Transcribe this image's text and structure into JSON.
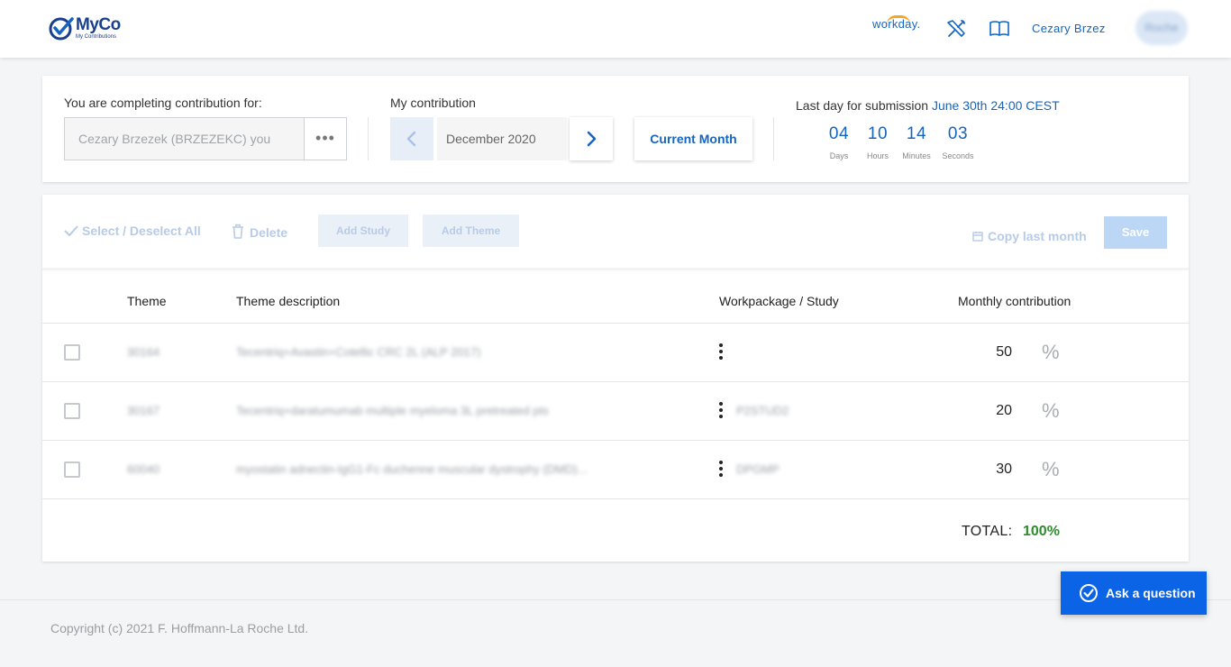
{
  "header": {
    "logo_name": "MyCo",
    "logo_sub": "My Contributions",
    "workday_label": "workday.",
    "username": "Cezary Brzez",
    "avatar_text": "Roche"
  },
  "selection": {
    "label": "You are completing contribution for:",
    "user_value": "Cezary Brzezek (BRZEZEKC) you",
    "more_label": "•••",
    "contribution_label": "My contribution",
    "month_value": "December 2020",
    "current_month_button": "Current Month",
    "deadline_prefix": "Last day for submission",
    "deadline_value": "June 30th 24:00 CEST",
    "countdown": [
      {
        "value": "04",
        "unit": "Days"
      },
      {
        "value": "10",
        "unit": "Hours"
      },
      {
        "value": "14",
        "unit": "Minutes"
      },
      {
        "value": "03",
        "unit": "Seconds"
      }
    ]
  },
  "toolbar": {
    "select_all": "Select / Deselect All",
    "delete": "Delete",
    "add_study": "Add Study",
    "add_theme": "Add Theme",
    "copy_last_month": "Copy last month",
    "save": "Save"
  },
  "table": {
    "columns": [
      "Theme",
      "Theme description",
      "Workpackage / Study",
      "Monthly contribution"
    ],
    "rows": [
      {
        "theme": "30164",
        "description": "Tecentriq+Avastin+Cotellic CRC 2L (ALP 2017)",
        "study": "",
        "contribution": "50",
        "unit": "%"
      },
      {
        "theme": "30167",
        "description": "Tecentriq+daratumumab multiple myeloma 3L pretreated pts",
        "study": "P2STUD2",
        "contribution": "20",
        "unit": "%"
      },
      {
        "theme": "60040",
        "description": "myostatin adnectin-IgG1-Fc duchenne muscular dystrophy (DMD)...",
        "study": "DPGMP",
        "contribution": "30",
        "unit": "%"
      }
    ],
    "total_label": "TOTAL:",
    "total_value": "100%"
  },
  "footer": {
    "copyright": "Copyright (c) 2021 F. Hoffmann-La Roche Ltd.",
    "ask_button": "Ask a question"
  },
  "colors": {
    "accent": "#1565c0",
    "brand": "#1b3f8f",
    "ask_button": "#0b63e5",
    "total_green": "#2e8b2e"
  }
}
